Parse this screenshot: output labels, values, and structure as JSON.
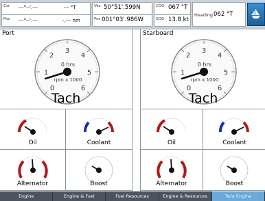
{
  "nav": {
    "csr_label": "Csr",
    "csr_value": "---°--'.---",
    "csr_unit": "--- °T",
    "pos_label": "Pos",
    "pos_value": "---°--'.---",
    "pos_unit": "-,--- nm",
    "ves_label": "Ves",
    "ves_value": "50°51'.599N",
    "pos2_label": "Pos",
    "pos2_value": "001°03'.986W",
    "cog_label": "COG",
    "cog_value": "067 °T",
    "sog_label": "SOG",
    "sog_value": "13.8 kt",
    "heading_label": "Heading",
    "heading_value": "062 °T"
  },
  "panels": {
    "port": {
      "label": "Port",
      "tach_title": "Tach",
      "tach_hours": "0 hrs",
      "tach_unit": "rpm x 1000",
      "ticks": [
        "0",
        "1",
        "2",
        "3",
        "4",
        "5",
        "6"
      ],
      "gauges": [
        "Oil",
        "Coolant",
        "Alternator",
        "Boost"
      ]
    },
    "starboard": {
      "label": "Starboard",
      "tach_title": "Tach",
      "tach_hours": "0 hrs",
      "tach_unit": "rpm x 1000",
      "ticks": [
        "0",
        "1",
        "2",
        "3",
        "4",
        "5",
        "6"
      ],
      "gauges": [
        "Oil",
        "Coolant",
        "Alternator",
        "Boost"
      ]
    }
  },
  "tabs": [
    {
      "label": "Engine",
      "active": false
    },
    {
      "label": "Engine & Fuel",
      "active": false
    },
    {
      "label": "Fuel Resources",
      "active": false
    },
    {
      "label": "Engine & Resources",
      "active": false
    },
    {
      "label": "Twin Engine",
      "active": true
    }
  ],
  "colors": {
    "gauge_red": "#b01818",
    "gauge_blue": "#1a2fb0",
    "active_tab": "#6aa9d8"
  }
}
